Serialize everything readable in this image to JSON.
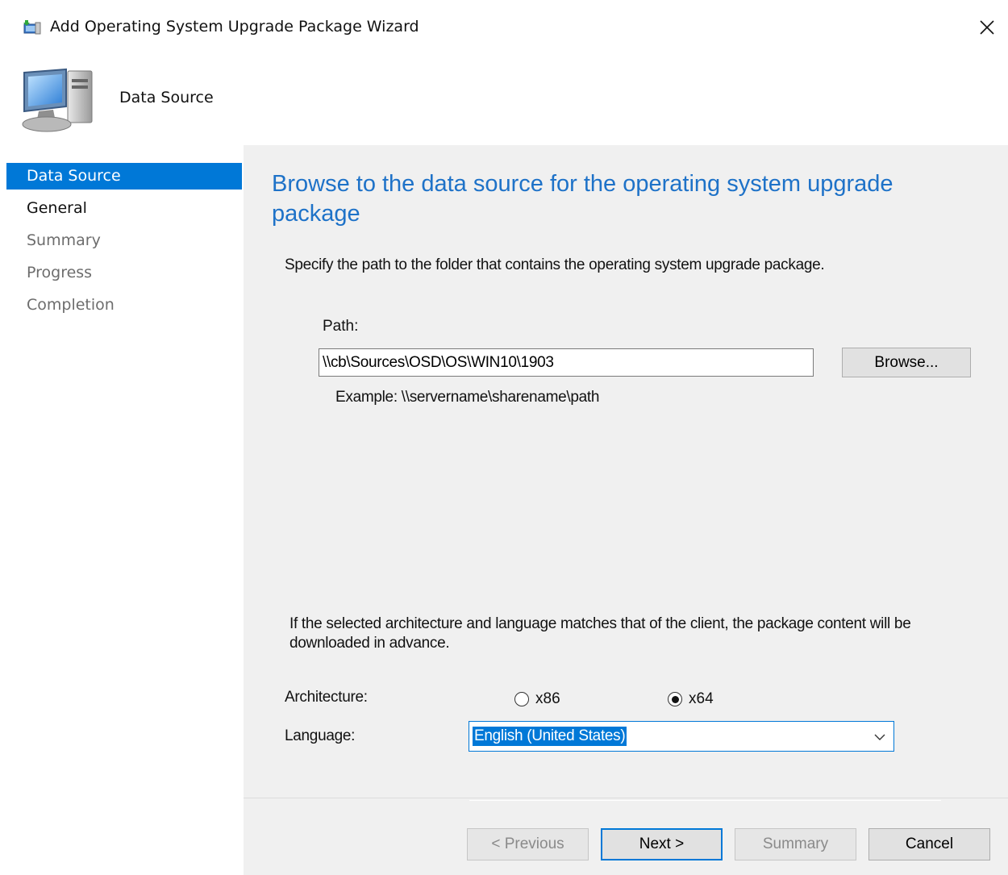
{
  "window": {
    "title": "Add Operating System Upgrade Package Wizard",
    "close_icon": "close-icon"
  },
  "header": {
    "title": "Data Source",
    "graphic_icon": "computer-icon"
  },
  "nav": {
    "items": [
      {
        "label": "Data Source",
        "state": "selected"
      },
      {
        "label": "General",
        "state": "enabled"
      },
      {
        "label": "Summary",
        "state": "disabled"
      },
      {
        "label": "Progress",
        "state": "disabled"
      },
      {
        "label": "Completion",
        "state": "disabled"
      }
    ]
  },
  "page": {
    "heading": "Browse to the data source for the operating system upgrade package",
    "instruction": "Specify the path to the folder that contains the operating system upgrade package.",
    "path_label": "Path:",
    "path_value": "\\\\cb\\Sources\\OSD\\OS\\WIN10\\1903",
    "browse_label": "Browse...",
    "example": "Example: \\\\servername\\sharename\\path",
    "arch_note": "If the selected architecture and language matches that of the client, the package content will be downloaded in advance.",
    "architecture_label": "Architecture:",
    "architecture_options": [
      {
        "label": "x86",
        "selected": false
      },
      {
        "label": "x64",
        "selected": true
      }
    ],
    "language_label": "Language:",
    "language_value": "English (United States)"
  },
  "footer": {
    "previous_label": "< Previous",
    "next_label": "Next >",
    "summary_label": "Summary",
    "cancel_label": "Cancel"
  },
  "colors": {
    "accent": "#0078d7",
    "heading": "#1e72c8",
    "content_bg": "#f0f0f0",
    "disabled_text": "#6d6d6d"
  }
}
